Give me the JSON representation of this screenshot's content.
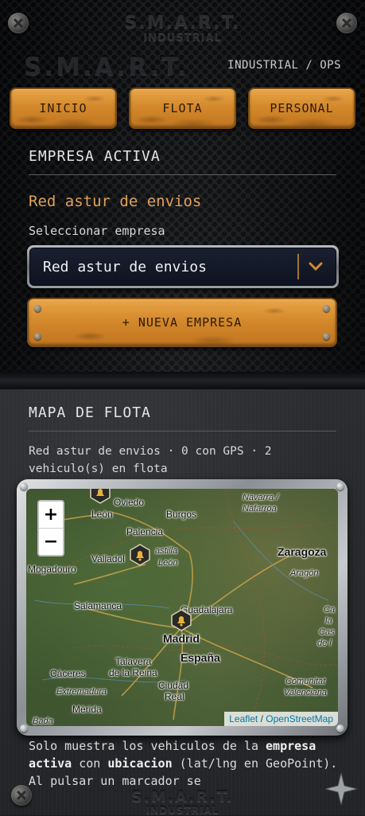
{
  "header": {
    "logo_line1": "S.M.A.R.T.",
    "logo_line2": "INDUSTRIAL",
    "brand": "S.M.A.R.T.",
    "subnav": "INDUSTRIAL / OPS"
  },
  "nav": {
    "inicio": "INICIO",
    "flota": "FLOTA",
    "personal": "PERSONAL"
  },
  "empresa": {
    "section_title": "EMPRESA ACTIVA",
    "active_name": "Red astur de envios",
    "select_label": "Seleccionar empresa",
    "select_value": "Red astur de envios",
    "new_button": "+ NUEVA EMPRESA"
  },
  "mapa": {
    "section_title": "MAPA DE FLOTA",
    "summary": "Red astur de envios · 0 con GPS · 2 vehiculo(s) en flota",
    "zoom_in": "+",
    "zoom_out": "−",
    "attribution_leaflet": "Leaflet",
    "attribution_sep": " / ",
    "attribution_osm": "OpenStreetMap",
    "places": {
      "oviedo": "Oviedo",
      "leon": "León",
      "burgos": "Burgos",
      "navarra1": "Navarra /",
      "navarra2": "Nafarroa",
      "palencia": "Palencia",
      "zaragoza": "Zaragoza",
      "valladolid": "Valladol",
      "castilla": "astilla",
      "castilla2": "León",
      "mogadouro": "Mogadouro",
      "aragon": "Aragón",
      "salamanca": "Salamanca",
      "guadalajara": "Guadalajara",
      "madrid": "Madrid",
      "espana": "España",
      "ca1": "Ca",
      "ca2": "la",
      "ca3": "Cas",
      "ca4": "de l",
      "talavera1": "Talavera",
      "talavera2": "de la Reina",
      "caceres": "Cáceres",
      "extremadura": "Extremadura",
      "ciudad1": "Ciudad",
      "ciudad2": "Real",
      "comunitat1": "Comunitat",
      "comunitat2": "Valenciana",
      "merida": "Mérida",
      "bada": "Bada"
    }
  },
  "footnote": {
    "p1": "Solo muestra los vehiculos de la ",
    "b1": "empresa activa",
    "p2": " con ",
    "b2": "ubicacion",
    "p3": " (lat/lng en GeoPoint). Al pulsar un marcador se"
  },
  "footer": {
    "logo_line1": "S.M.A.R.T.",
    "logo_line2": "INDUSTRIAL"
  },
  "colors": {
    "accent_orange": "#d4892c",
    "active_name": "#e0a25a",
    "background": "#1b1d20"
  }
}
